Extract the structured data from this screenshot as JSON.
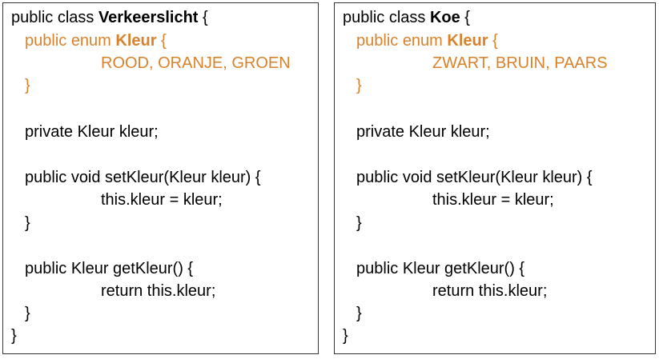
{
  "panels": [
    {
      "class_prefix": "public class ",
      "class_name": "Verkeerslicht",
      "class_brace": " {",
      "enum_prefix": "public enum ",
      "enum_name": "Kleur",
      "enum_brace": " {",
      "enum_values": "ROOD, ORANJE, GROEN",
      "enum_close": "}",
      "field": "private Kleur kleur;",
      "setter_sig": "public void setKleur(Kleur kleur) {",
      "setter_body": "this.kleur = kleur;",
      "setter_close": "}",
      "getter_sig": "public Kleur getKleur() {",
      "getter_body": "return this.kleur;",
      "getter_close": "}",
      "class_close": "}"
    },
    {
      "class_prefix": "public class ",
      "class_name": "Koe",
      "class_brace": " {",
      "enum_prefix": "public enum ",
      "enum_name": "Kleur",
      "enum_brace": " {",
      "enum_values": "ZWART, BRUIN, PAARS",
      "enum_close": "}",
      "field": "private Kleur kleur;",
      "setter_sig": "public void setKleur(Kleur kleur) {",
      "setter_body": "this.kleur = kleur;",
      "setter_close": "}",
      "getter_sig": "public Kleur getKleur() {",
      "getter_body": "return this.kleur;",
      "getter_close": "}",
      "class_close": "}"
    }
  ],
  "colors": {
    "keyword_highlight": "#D9822B",
    "text": "#000000",
    "border": "#333333"
  }
}
